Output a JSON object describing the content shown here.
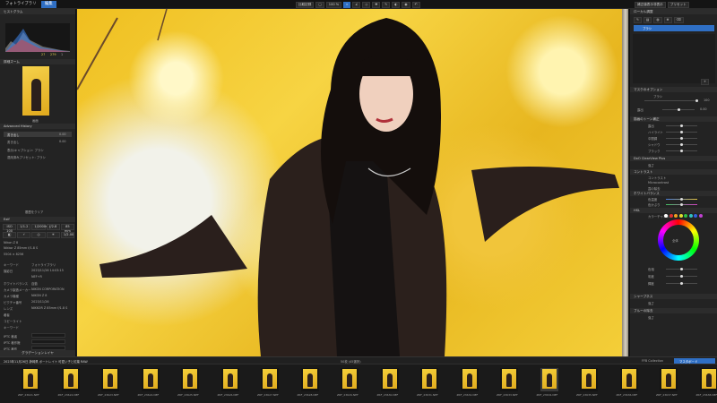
{
  "topbar": {
    "tab_photo_library": "フォトライブラリ",
    "tab_edit": "編集",
    "compare_label": "比較記録",
    "zoom_label": "100 %",
    "right_btn_1": "補正値表示非表示",
    "right_btn_2": "プリセット"
  },
  "left": {
    "histogram_title": "ヒストグラム",
    "histogram_values": [
      "27",
      "279",
      "1"
    ],
    "navigator_title": "詳細ズーム",
    "nav_caption": "画面",
    "advanced_history_title": "Advanced History",
    "history": [
      "書き出し",
      "書き出し",
      "表示/キャプション: ブラシ",
      "適用済みプリセット: ブラシ"
    ],
    "history_values": [
      "0.00",
      "0.00"
    ],
    "history_footer": "履歴をクリア",
    "exif_title": "Exif",
    "exif_chips": [
      "ISO 100",
      "1/1.2",
      "1/2000s",
      "ƒ/2.8",
      "85 mm"
    ],
    "lens": "Nikon Z 8",
    "lens_sub": "Nikkor Z 85mm f/1.8 S",
    "exif_extra": "1/2.00",
    "dims": "5504 × 8256",
    "meta_rows": [
      {
        "k": "キーワード",
        "v": "フォトライブラリ"
      },
      {
        "k": "撮影日",
        "v": "2023/11/26 14:03:15"
      },
      {
        "k": "",
        "v": "NEF+R"
      },
      {
        "k": "ホワイトバランス",
        "v": "自動"
      },
      {
        "k": "カメラ製造メーカー",
        "v": "NIKON CORPORATION"
      },
      {
        "k": "カメラ機種",
        "v": "NIKON Z 8"
      },
      {
        "k": "ピクチャ番号",
        "v": "2023/11/26"
      },
      {
        "k": "レンズ",
        "v": "NIKKOR Z 85mm f/1.8 S"
      },
      {
        "k": "著者",
        "v": ""
      },
      {
        "k": "コピーライト",
        "v": ""
      },
      {
        "k": "キーワード",
        "v": ""
      }
    ],
    "iptc_rows": [
      "IPTC 著者",
      "IPTC 著作権",
      "IPTC 著作"
    ],
    "bottom_title": "グラデーションレイヤ"
  },
  "right": {
    "top_btn_1": "補正値表示/非表示",
    "top_btn_2": "プリセット",
    "section_local": "ローカル調整",
    "brush_label": "ブラシ",
    "mask_title": "マスクのオプション",
    "mask_sub": "ブラシ",
    "mask_opacity": "100",
    "exposure": "露出",
    "exposure_val": "0.00",
    "light_title": "描画のトーン補正",
    "light_rows": [
      "露出",
      "ハイライト",
      "中間調",
      "シャドウ",
      "ブラック"
    ],
    "dxo_title": "DxO ClearView Plus",
    "dxo_row": "強さ",
    "contrast_title": "コントラスト",
    "contrast_rows": [
      "コントラスト",
      "Microcontrast",
      "霞の除去"
    ],
    "wb_title": "ホワイトバランス",
    "wb_rows": [
      "色温度",
      "色かぶり"
    ],
    "hsl_title": "HSL",
    "hsl_channel": "カラーチャンネル",
    "hsl_rows": [
      "色相",
      "彩度",
      "輝度"
    ],
    "sharp_title": "シャープネス",
    "sharp_row": "強さ",
    "noise_title": "ブルーの除去",
    "noise_row": "強さ",
    "wheel_center": "全体"
  },
  "filmstrip": {
    "folder": "2023年11月26日 静岡県 ポートレイト 可愛い子と紅葉 RAW",
    "count": "50枚 (45選択)",
    "view_tab": "FFB Collection",
    "active_tab": "マスタボード",
    "thumbs": [
      "ZRF_23621.NEF",
      "ZRF_23622.NEF",
      "ZRF_23623.NEF",
      "ZRF_23624.NEF",
      "ZRF_23625.NEF",
      "ZRF_23626.NEF",
      "ZRF_23627.NEF",
      "ZRF_23628.NEF",
      "ZRF_23629.NEF",
      "ZRF_23630.NEF",
      "ZRF_23631.NEF",
      "ZRF_23632.NEF",
      "ZRF_23633.NEF",
      "ZRF_23634.NEF",
      "ZRF_23635.NEF",
      "ZRF_23636.NEF",
      "ZRF_23637.NEF",
      "ZRF_23638.NEF"
    ]
  },
  "colors": {
    "accent": "#2f6fc4",
    "panel": "#232323",
    "foliage": "#f2c531"
  }
}
